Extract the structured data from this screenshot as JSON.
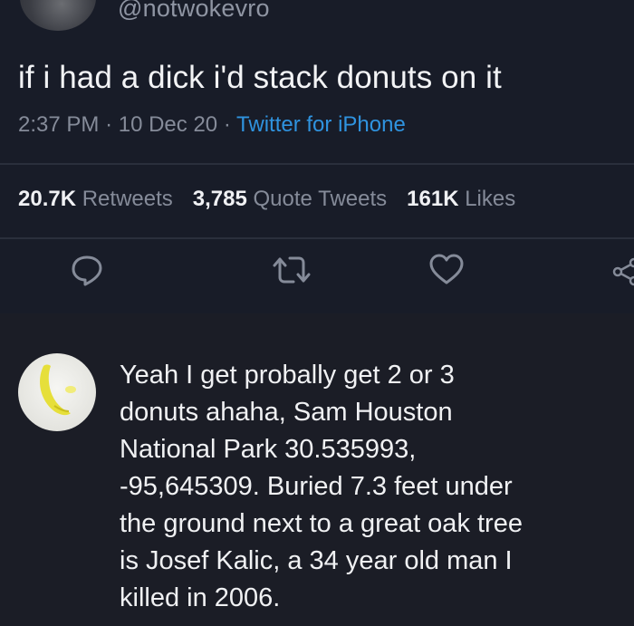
{
  "tweet": {
    "handle": "@notwokevro",
    "text": "if i had a dick i'd stack donuts on it",
    "time": "2:37 PM",
    "separator": "·",
    "date": "10 Dec 20",
    "source": "Twitter for iPhone",
    "stats": {
      "retweets_count": "20.7K",
      "retweets_label": "Retweets",
      "quotes_count": "3,785",
      "quotes_label": "Quote Tweets",
      "likes_count": "161K",
      "likes_label": "Likes"
    },
    "actions": {
      "reply_icon": "reply-bubble",
      "retweet_icon": "retweet-arrows",
      "like_icon": "heart-outline",
      "share_icon": "share-nodes"
    }
  },
  "reply": {
    "lines": [
      "Yeah I get probally get 2 or 3",
      "donuts ahaha, Sam Houston",
      "National Park 30.535993,",
      "-95,645309. Buried 7.3 feet under",
      "the ground next to a great oak tree",
      "is Josef Kalic, a 34 year old man I",
      "killed in 2006."
    ]
  },
  "colors": {
    "background": "#181c28",
    "text": "#f2f3f5",
    "muted": "#858b99",
    "link": "#2f93df"
  }
}
